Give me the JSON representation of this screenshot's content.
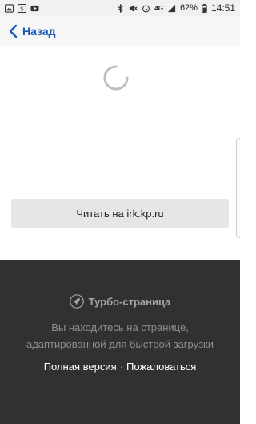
{
  "status_bar": {
    "battery_percent": "62%",
    "time": "14:51",
    "network": "4G",
    "left_icons": [
      "gallery-icon",
      "s-app-icon",
      "youtube-icon"
    ],
    "right_icons": [
      "bluetooth-icon",
      "mute-icon",
      "alarm-icon",
      "signal-icon",
      "battery-icon"
    ]
  },
  "nav": {
    "back_label": "Назад"
  },
  "content": {
    "read_button_label": "Читать на irk.kp.ru"
  },
  "footer": {
    "turbo_label": "Турбо-страница",
    "description": "Вы находитесь на странице, адаптированной для быстрой загрузки",
    "full_version_label": "Полная версия",
    "separator": "·",
    "report_label": "Пожаловаться"
  },
  "colors": {
    "accent": "#1b57b8",
    "footer_bg": "#313131",
    "button_bg": "#e6e6e6"
  }
}
